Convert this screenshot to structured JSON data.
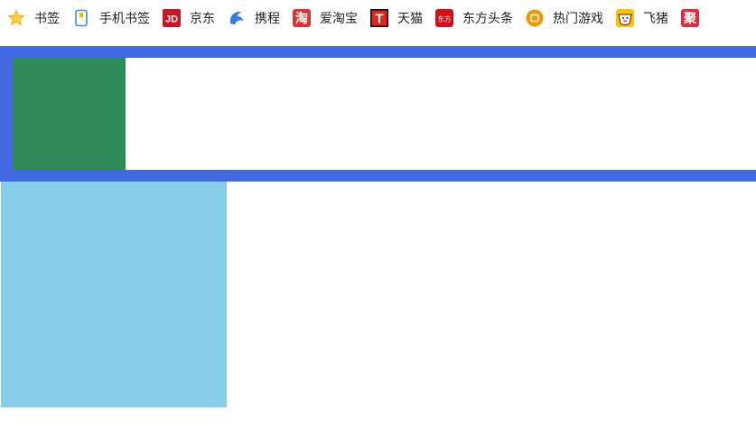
{
  "bookmarks": [
    {
      "label": "书签",
      "icon": "star-icon"
    },
    {
      "label": "手机书签",
      "icon": "phone-bookmark-icon"
    },
    {
      "label": "京东",
      "icon": "jd-logo-icon",
      "glyph": "JD"
    },
    {
      "label": "携程",
      "icon": "ctrip-dolphin-icon"
    },
    {
      "label": "爱淘宝",
      "icon": "taobao-icon",
      "glyph": "淘"
    },
    {
      "label": "天猫",
      "icon": "tmall-icon",
      "glyph": "T"
    },
    {
      "label": "东方头条",
      "icon": "dongfang-icon",
      "glyph": "东方"
    },
    {
      "label": "热门游戏",
      "icon": "games-icon"
    },
    {
      "label": "飞猪",
      "icon": "fliggy-icon"
    },
    {
      "label": "",
      "icon": "ju-icon",
      "glyph": "聚"
    }
  ],
  "colors": {
    "frame_border": "#4169e1",
    "green_box": "#2e8b57",
    "skyblue_box": "#87ceeb",
    "jd_red": "#c81623",
    "taobao_red": "#d9352f",
    "tmall_red": "#e1251b",
    "dongfang_red": "#d40f1a",
    "games_orange": "#f39800",
    "fliggy_yellow": "#ffc300",
    "ju_red": "#e02a3c"
  }
}
